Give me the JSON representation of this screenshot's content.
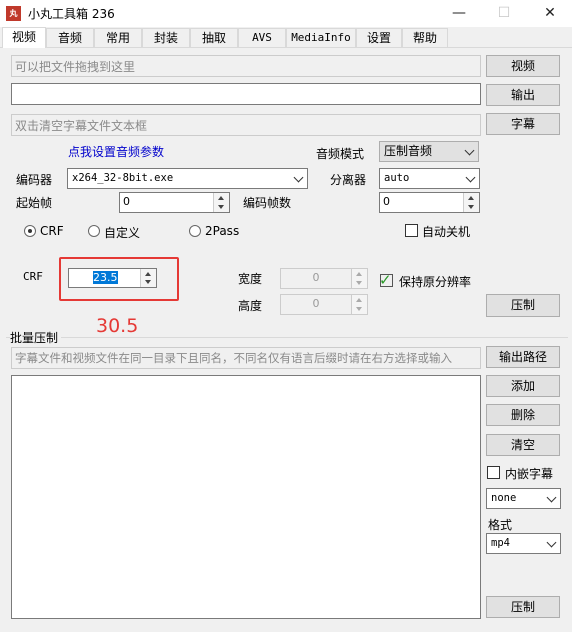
{
  "window": {
    "title": "小丸工具箱 236",
    "icon_text": "丸",
    "minimize": "—",
    "maximize": "☐",
    "close": "✕"
  },
  "tabs": [
    "视频",
    "音频",
    "常用",
    "封装",
    "抽取",
    "AVS",
    "MediaInfo",
    "设置",
    "帮助"
  ],
  "video": {
    "drop_placeholder": "可以把文件拖拽到这里",
    "video_button": "视频",
    "output_button": "输出",
    "subtitle_placeholder": "双击清空字幕文件文本框",
    "subtitle_button": "字幕",
    "audio_params_link": "点我设置音频参数",
    "audio_mode_label": "音频模式",
    "audio_mode_value": "压制音频",
    "encoder_label": "编码器",
    "encoder_value": "x264_32-8bit.exe",
    "splitter_label": "分离器",
    "splitter_value": "auto",
    "start_frame_label": "起始帧",
    "start_frame_value": "0",
    "frame_count_label": "编码帧数",
    "frame_count_value": "0",
    "mode_crf": "CRF",
    "mode_custom": "自定义",
    "mode_2pass": "2Pass",
    "auto_shutdown": "自动关机",
    "crf_label": "CRF",
    "crf_value": "23.5",
    "annotation": "30.5",
    "width_label": "宽度",
    "width_value": "0",
    "height_label": "高度",
    "height_value": "0",
    "keep_resolution": "保持原分辨率",
    "encode_button": "压制"
  },
  "batch": {
    "group_title": "批量压制",
    "hint_placeholder": "字幕文件和视频文件在同一目录下且同名，不同名仅有语言后缀时请在右方选择或输入",
    "output_path_button": "输出路径",
    "add_button": "添加",
    "delete_button": "删除",
    "clear_button": "清空",
    "embed_sub_label": "内嵌字幕",
    "sub_lang_value": "none",
    "format_label": "格式",
    "format_value": "mp4",
    "encode_button": "压制"
  }
}
